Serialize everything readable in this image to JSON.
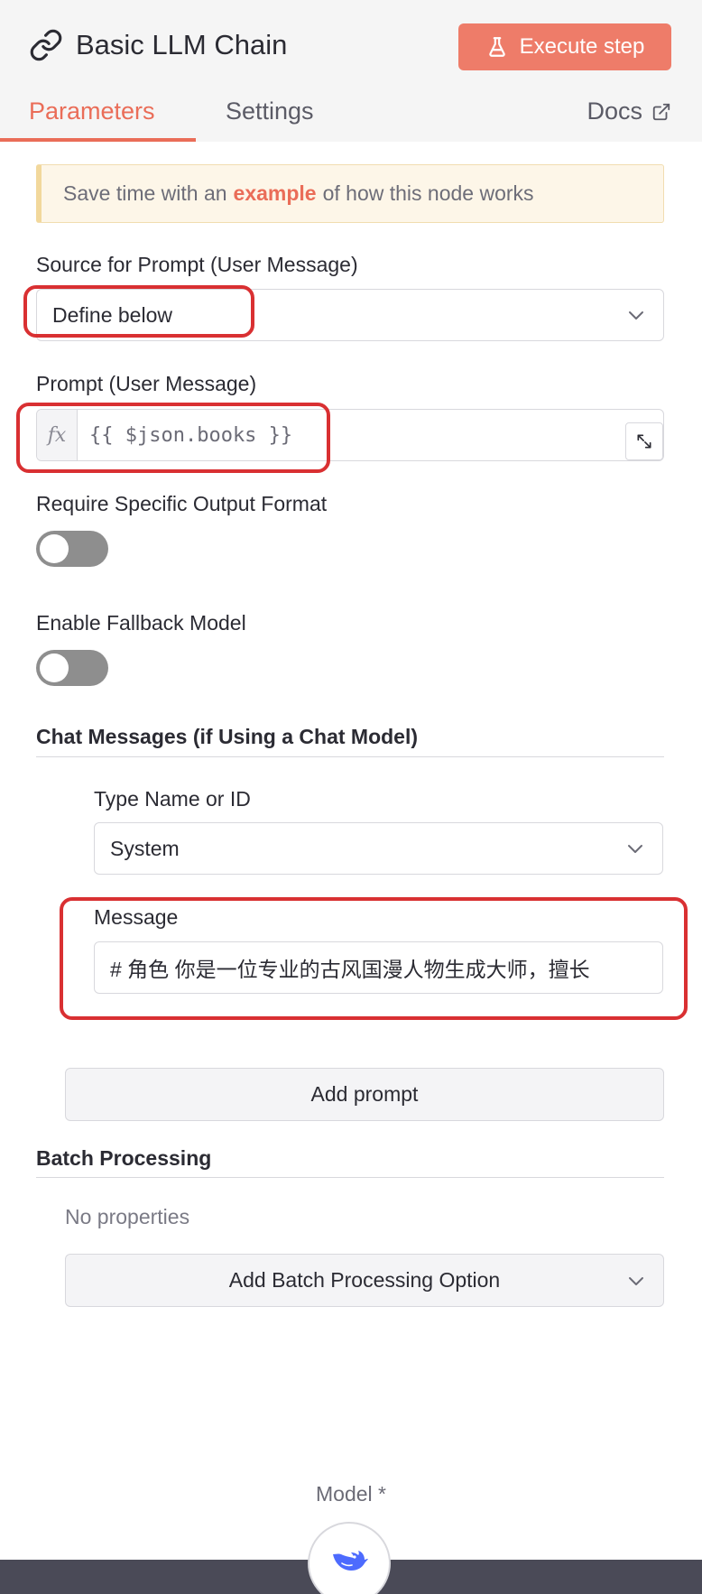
{
  "header": {
    "title": "Basic LLM Chain",
    "execute_label": "Execute step",
    "accent": "#ea6d58"
  },
  "tabs": {
    "parameters": "Parameters",
    "settings": "Settings",
    "docs": "Docs"
  },
  "notice": {
    "before": "Save time with an",
    "highlight": "example",
    "after": "of how this node works"
  },
  "source_prompt": {
    "label": "Source for Prompt (User Message)",
    "value": "Define below"
  },
  "prompt": {
    "label": "Prompt (User Message)",
    "fx": "fx",
    "value": "{{ $json.books }}"
  },
  "output_format": {
    "label": "Require Specific Output Format",
    "enabled": false
  },
  "fallback": {
    "label": "Enable Fallback Model",
    "enabled": false
  },
  "chat_messages": {
    "title": "Chat Messages (if Using a Chat Model)",
    "type_label": "Type Name or ID",
    "type_value": "System",
    "message_label": "Message",
    "message_value": "# 角色 你是一位专业的古风国漫人物生成大师，擅长",
    "add_prompt": "Add prompt"
  },
  "batch": {
    "title": "Batch Processing",
    "empty": "No properties",
    "add_option": "Add Batch Processing Option"
  },
  "model": {
    "label": "Model *",
    "icon": "deepseek-whale-icon"
  },
  "colors": {
    "highlight_box": "#d93032",
    "execute_button": "#ee7c69",
    "toggle_off": "#8e8e8e"
  }
}
